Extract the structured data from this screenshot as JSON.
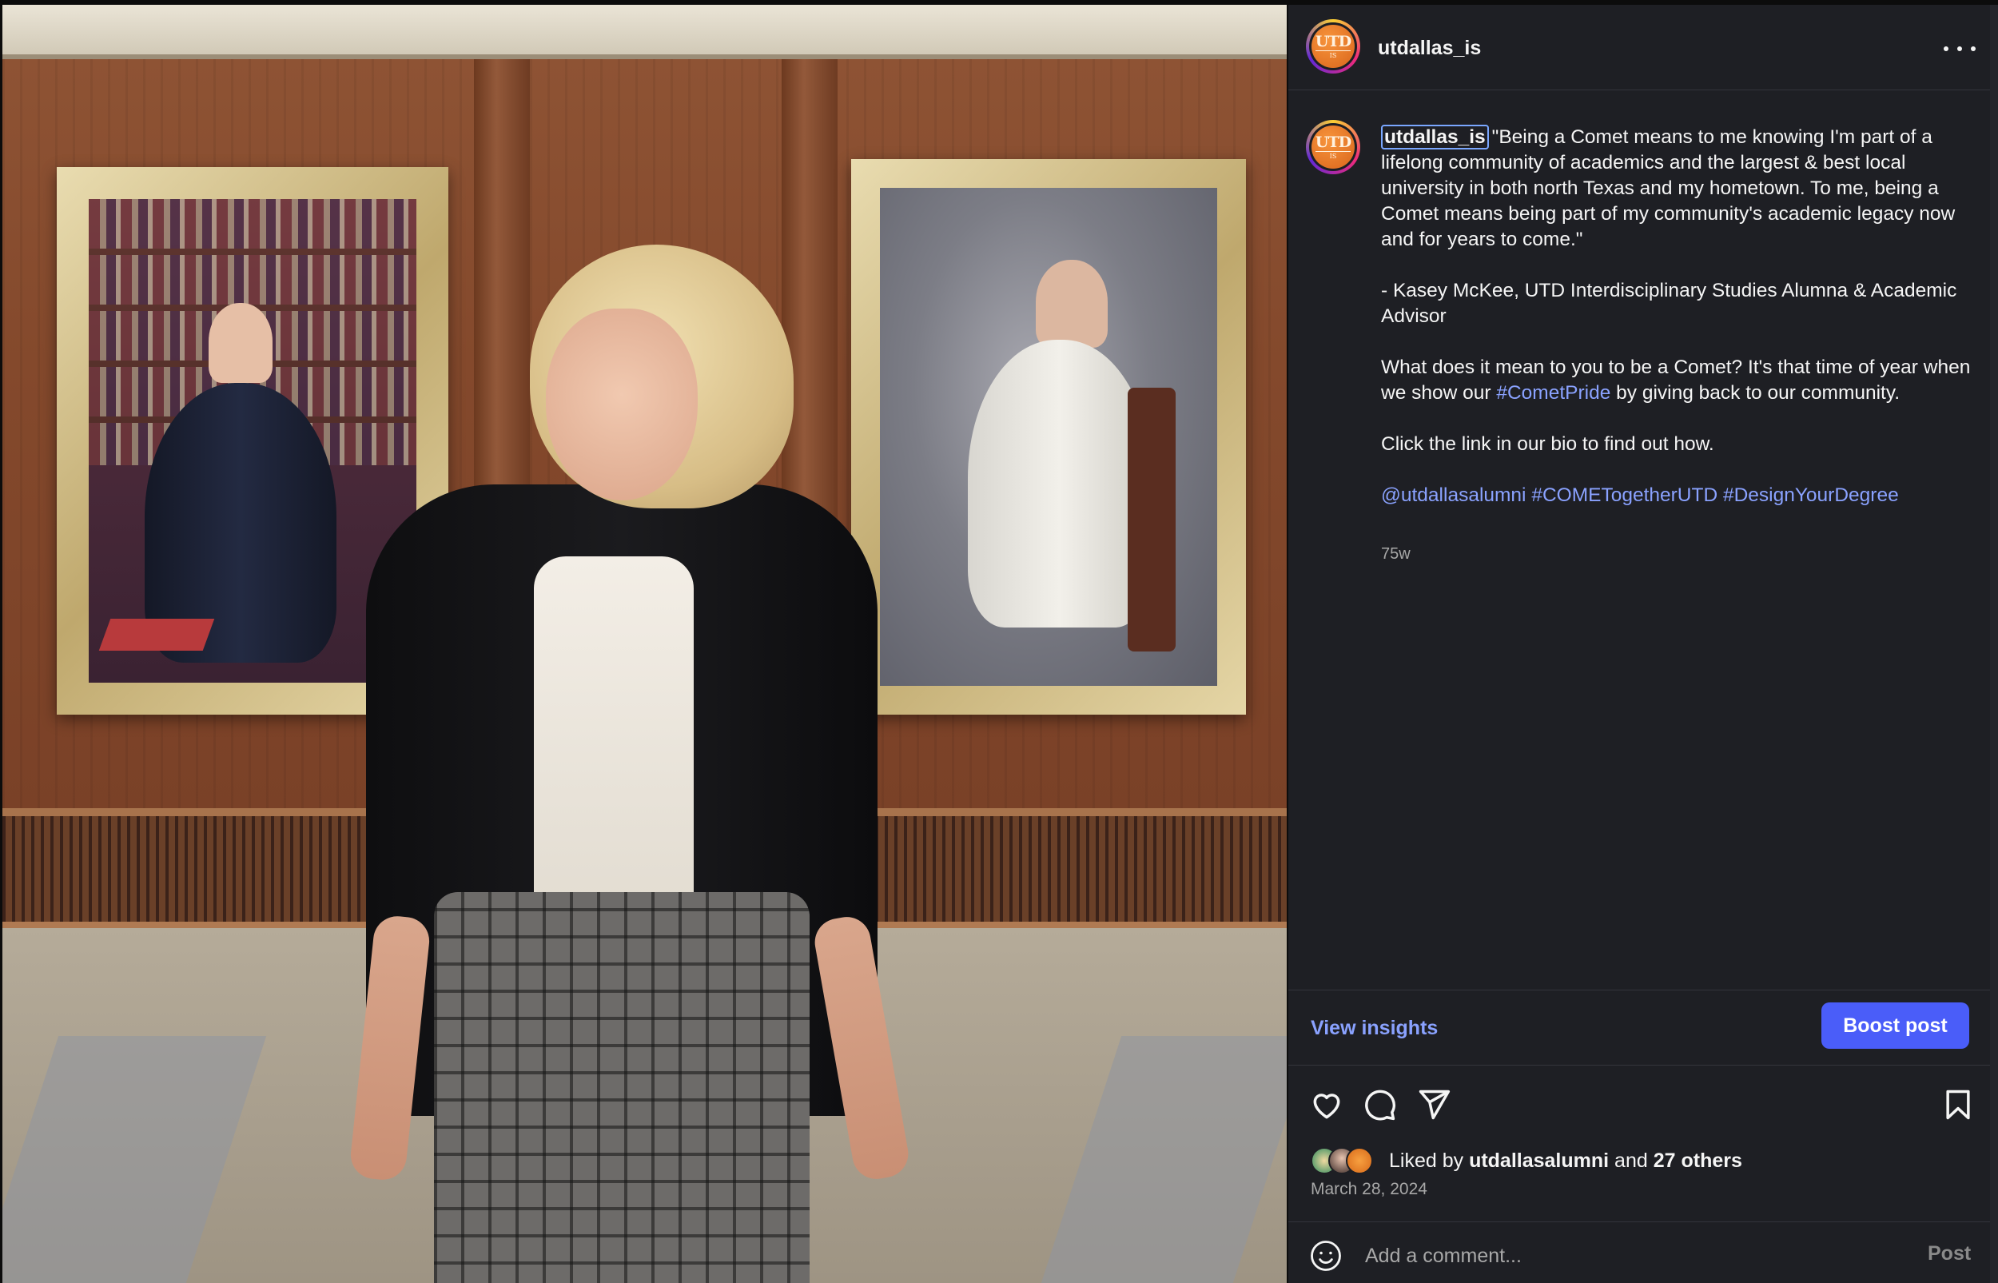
{
  "post": {
    "username": "utdallas_is",
    "avatar_logo": {
      "big": "UTD",
      "small": "IS"
    },
    "caption": {
      "owner": "utdallas_is",
      "quote": "\"Being a Comet means to me knowing I'm part of a lifelong community of academics and the largest & best local university in both north Texas and my hometown. To me, being a Comet means being part of my community's academic legacy now and for years to come.\"",
      "attribution": "- Kasey McKee, UTD Interdisciplinary Studies Alumna & Academic Advisor",
      "question_before": "What does it mean to you to be a Comet? It's that time of year when we show our ",
      "question_hashtag": "#CometPride",
      "question_after": " by giving back to our community.",
      "bio_line": "Click the link in our bio to find out how.",
      "tags": [
        "@utdallasalumni",
        "#COMETogetherUTD",
        "#DesignYourDegree"
      ]
    },
    "time_ago": "75w",
    "view_insights": "View insights",
    "boost_post": "Boost post",
    "likes": {
      "prefix": "Liked by ",
      "user": "utdallasalumni",
      "middle": " and ",
      "others": "27 others"
    },
    "date": "March 28, 2024",
    "comment": {
      "placeholder": "Add a comment...",
      "post_label": "Post"
    }
  },
  "icons": {
    "more": "more-options-icon",
    "like": "heart-icon",
    "comment": "comment-icon",
    "share": "share-icon",
    "save": "bookmark-icon",
    "emoji": "emoji-icon"
  },
  "colors": {
    "panel_bg": "#1e1f24",
    "link": "#8aa2ff",
    "boost": "#4a5df9",
    "muted": "#a8a8a8"
  }
}
